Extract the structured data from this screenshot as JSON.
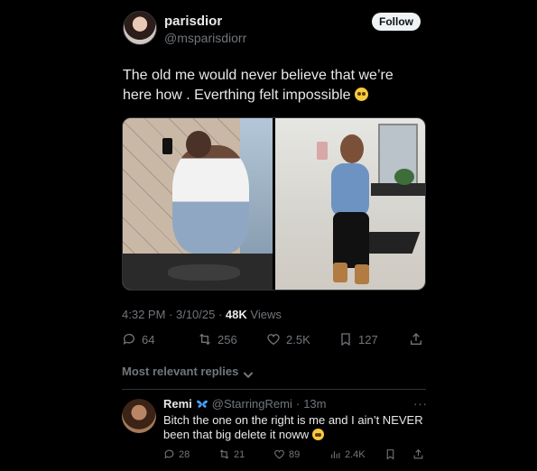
{
  "author": {
    "name": "parisdior",
    "handle": "@msparisdiorr"
  },
  "follow_label": "Follow",
  "tweet": {
    "text": "The old me would never believe that we’re here how . Everthing felt impossible",
    "emoji": "pleading-face"
  },
  "meta": {
    "time": "4:32 PM",
    "separator": " · ",
    "date": "3/10/25",
    "views_count": "48K",
    "views_label": " Views"
  },
  "actions": {
    "replies": "64",
    "reposts": "256",
    "likes": "2.5K",
    "bookmarks": "127"
  },
  "replies_sort_label": "Most relevant replies",
  "reply": {
    "name": "Remi",
    "handle": "@StarringRemi",
    "dot": "·",
    "age": "13m",
    "text": "Bitch the one on the right is me and I ain’t NEVER been that big delete it noww",
    "more": "···",
    "counts": {
      "replies": "28",
      "reposts": "21",
      "likes": "89",
      "views": "2.4K"
    }
  },
  "colors": {
    "background": "#000000",
    "text": "#e7e9ea",
    "muted": "#71767b",
    "butterfly": "#4aa3ff"
  }
}
